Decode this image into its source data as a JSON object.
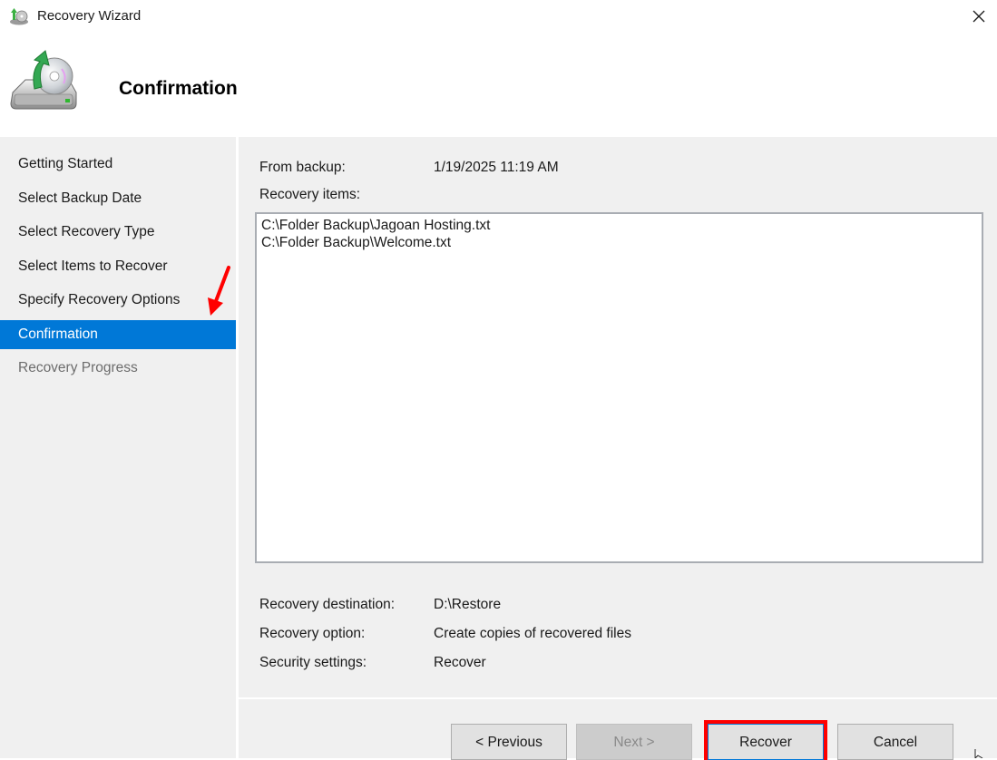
{
  "window": {
    "title": "Recovery Wizard",
    "close_icon": "close-icon"
  },
  "header": {
    "icon": "backup-restore-icon",
    "title": "Confirmation"
  },
  "nav": {
    "items": [
      {
        "label": "Getting Started",
        "state": "normal"
      },
      {
        "label": "Select Backup Date",
        "state": "normal"
      },
      {
        "label": "Select Recovery Type",
        "state": "normal"
      },
      {
        "label": "Select Items to Recover",
        "state": "normal"
      },
      {
        "label": "Specify Recovery Options",
        "state": "normal"
      },
      {
        "label": "Confirmation",
        "state": "active"
      },
      {
        "label": "Recovery Progress",
        "state": "disabled"
      }
    ],
    "annotation": "red-arrow-pointing-to-confirmation"
  },
  "details": {
    "from_backup_label": "From backup:",
    "from_backup_value": "1/19/2025 11:19 AM",
    "recovery_items_label": "Recovery items:",
    "recovery_items": [
      "C:\\Folder Backup\\Jagoan Hosting.txt",
      "C:\\Folder Backup\\Welcome.txt"
    ],
    "destination_label": "Recovery destination:",
    "destination_value": "D:\\Restore",
    "option_label": "Recovery option:",
    "option_value": "Create copies of recovered files",
    "security_label": "Security settings:",
    "security_value": "Recover"
  },
  "buttons": {
    "previous": "< Previous",
    "next": "Next >",
    "recover": "Recover",
    "cancel": "Cancel"
  },
  "colors": {
    "accent": "#0078d7",
    "highlight": "#ff0000",
    "panel_bg": "#f0f0f0"
  }
}
